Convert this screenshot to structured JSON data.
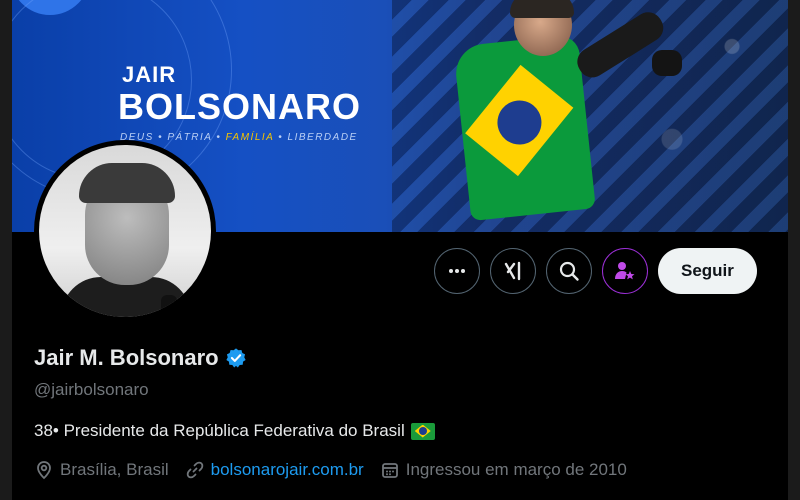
{
  "banner": {
    "name_top": "JAIR",
    "name_main": "BOLSONARO",
    "slogan_parts": [
      "DEUS",
      "PÁTRIA",
      "FAMÍLIA",
      "LIBERDADE"
    ]
  },
  "actions": {
    "more_icon": "more-icon",
    "grok_icon": "grok-icon",
    "search_icon": "search-icon",
    "subscribe_icon": "subscribe-star-person-icon",
    "follow_label": "Seguir"
  },
  "profile": {
    "display_name": "Jair M. Bolsonaro",
    "verified": true,
    "handle": "@jairbolsonaro",
    "bio": "38• Presidente da República Federativa do Brasil",
    "bio_emoji": "brazil-flag",
    "location": "Brasília, Brasil",
    "website": "bolsonarojair.com.br",
    "joined": "Ingressou em março de 2010"
  },
  "colors": {
    "accent": "#1d9bf0",
    "muted": "#71767b",
    "subscribe_border": "#9b2fd6",
    "slogan_highlight": "#f5c400"
  }
}
